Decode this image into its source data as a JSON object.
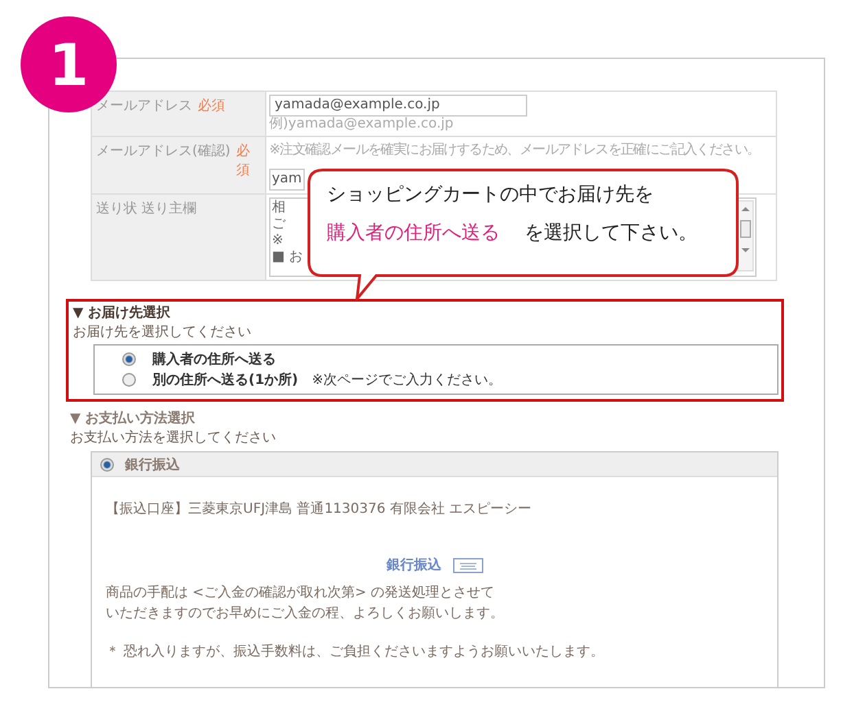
{
  "step_badge": "1",
  "form": {
    "rows": [
      {
        "kind": "input",
        "label": "メールアドレス",
        "required": "必須",
        "value": "yamada@example.co.jp",
        "hint": "例)yamada@example.co.jp"
      },
      {
        "kind": "input",
        "label": "メールアドレス(確認)",
        "required": "必須",
        "note": "※注文確認メールを確実にお届けするため、メールアドレスを正確にご記入ください。",
        "value": "yam"
      },
      {
        "kind": "textarea",
        "label": "送り状 送り主欄",
        "lines": [
          "相",
          "ご",
          "※",
          "■ お"
        ]
      }
    ]
  },
  "callout": {
    "line": "ショッピングカートの中でお届け先を",
    "highlight": "購入者の住所へ送る",
    "rest": "を選択して下さい。"
  },
  "delivery": {
    "title": "▼ お届け先選択",
    "subtitle": "お届け先を選択してください",
    "options": [
      {
        "label": "購入者の住所へ送る",
        "selected": true
      },
      {
        "label": "別の住所へ送る(1か所)",
        "note": "※次ページでご入力ください。",
        "selected": false
      }
    ]
  },
  "payment": {
    "title": "▼ お支払い方法選択",
    "subtitle": "お支払い方法を選択してください",
    "methods": [
      {
        "label": "銀行振込",
        "selected": true,
        "account": "【振込口座】三菱東京UFJ津島 普通1130376 有限会社 エスピーシー",
        "heading": "銀行振込",
        "paragraph": [
          "商品の手配は <ご入金の確認が取れ次第> の発送処理とさせて",
          "いただきますのでお早めにご入金の程、よろしくお願いします。"
        ],
        "note": "＊ 恐れ入りますが、振込手数料は、ご負担くださいますようお願いいたします。"
      }
    ]
  }
}
